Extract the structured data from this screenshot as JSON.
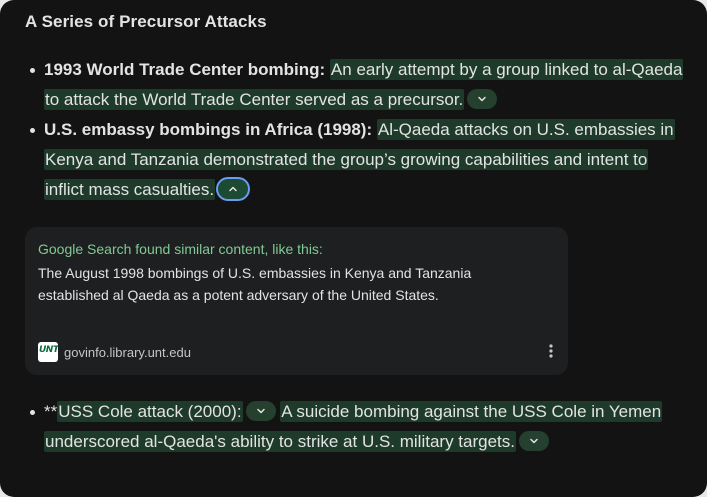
{
  "header": {
    "title": "A Series of Precursor Attacks"
  },
  "items": [
    {
      "bold": "1993 World Trade Center bombing:",
      "text": "An early attempt by a group linked to al-Qaeda to attack the World Trade Center served as a precursor.",
      "chip_icon": "chevron-down-icon"
    },
    {
      "bold": "U.S. embassy bombings in Africa (1998):",
      "text": "Al-Qaeda attacks on U.S. embassies in Kenya and Tanzania demonstrated the group’s growing capabilities and intent to inflict mass casualties.",
      "chip_icon": "chevron-up-icon"
    },
    {
      "prefix": "**",
      "text_a": "USS Cole attack (2000):",
      "text_b": "A suicide bombing against the USS Cole in Yemen underscored al-Qaeda's ability to strike at U.S. military targets.",
      "chip_icon": "chevron-down-icon"
    }
  ],
  "source_card": {
    "heading": "Google Search found similar content, like this:",
    "body": "The August 1998 bombings of U.S. embassies in Kenya and Tanzania established al Qaeda as a potent adversary of the United States.",
    "source_domain": "govinfo.library.unt.edu",
    "favicon_text": "UNT",
    "more_icon": "more-vert-icon"
  },
  "colors": {
    "background": "#131314",
    "highlight": "#1e3a2a",
    "card": "#1e1f20",
    "accent_green": "#81c995",
    "focus_ring": "#6a9cf5"
  }
}
